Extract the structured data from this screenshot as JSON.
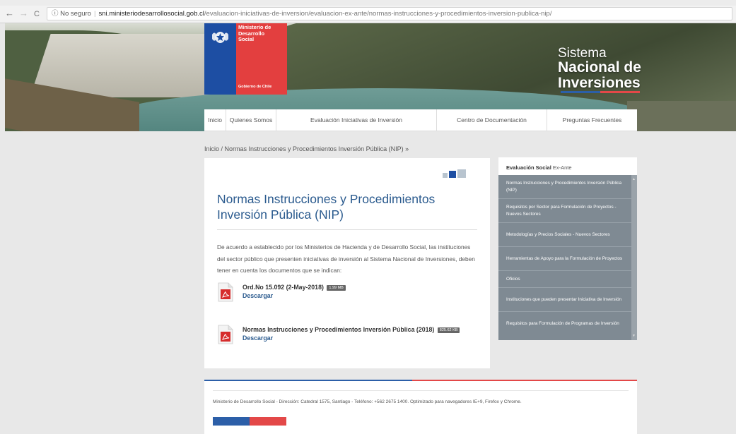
{
  "browser": {
    "back": "←",
    "forward": "→",
    "reload": "C",
    "security": "ⓘ No seguro",
    "host": "sni.ministeriodesarrollosocial.gob.cl",
    "path": "/evaluacion-iniciativas-de-inversion/evaluacion-ex-ante/normas-instrucciones-y-procedimientos-inversion-publica-nip/"
  },
  "logo": {
    "ministry_line1": "Ministerio de",
    "ministry_line2": "Desarrollo",
    "ministry_line3": "Social",
    "gobierno": "Gobierno de Chile"
  },
  "site_title": {
    "line1": "Sistema",
    "line2": "Nacional de",
    "line3": "Inversiones"
  },
  "nav": {
    "items": [
      {
        "label": "Inicio"
      },
      {
        "label": "Quienes Somos"
      },
      {
        "label": "Evaluación Iniciativas de Inversión"
      },
      {
        "label": "Centro de Documentación"
      },
      {
        "label": "Preguntas Frecuentes"
      }
    ]
  },
  "breadcrumb": "Inicio / Normas Instrucciones y Procedimientos Inversión Pública (NIP) »",
  "content": {
    "title": "Normas Instrucciones y Procedimientos Inversión Pública (NIP)",
    "intro": "De acuerdo a establecido por los Ministerios de Hacienda y de Desarrollo Social, las instituciones del sector público que presenten iniciativas de inversión al Sistema Nacional de Inversiones, deben tener en cuenta los documentos que se indican:",
    "documents": [
      {
        "title": "Ord.No 15.092 (2-May-2018)",
        "size": "1.99 MB",
        "link": "Descargar"
      },
      {
        "title": "Normas Instrucciones y Procedimientos Inversión Pública (2018)",
        "size": "825.62 KB",
        "link": "Descargar"
      }
    ]
  },
  "sidebar": {
    "heading_bold": "Evaluación Social",
    "heading_rest": " Ex-Ante",
    "items": [
      {
        "label": "Normas Instrucciones y Procedimientos Inversión Pública (NIP)"
      },
      {
        "label": "Requisitos por Sector para Formulación de Proyectos - Nuevos Sectores"
      },
      {
        "label": "Metodologías y Precios Sociales - Nuevos Sectores"
      },
      {
        "label": "Herramientas de Apoyo para la Formulación de Proyectos"
      },
      {
        "label": "Oficios"
      },
      {
        "label": "Instituciones que pueden presentar Iniciativa de Inversión"
      },
      {
        "label": "Requisitos para Formulación de Programas de Inversión"
      }
    ]
  },
  "footer": {
    "text": "Ministerio de Desarrollo Social - Dirección: Catedral 1575, Santiago - Teléfono: +562 2675 1400. Optimizado para navegadores IE+9, Firefox y Chrome."
  },
  "colors": {
    "brand_blue": "#1d4ea3",
    "brand_red": "#e33f3f",
    "title_blue": "#2a5a8e",
    "sidebar_gray": "#7f8a93"
  },
  "icons": [
    "back-icon",
    "forward-icon",
    "reload-icon",
    "info-icon",
    "pdf-icon",
    "font-size-icon",
    "scroll-up-icon",
    "scroll-down-icon"
  ]
}
